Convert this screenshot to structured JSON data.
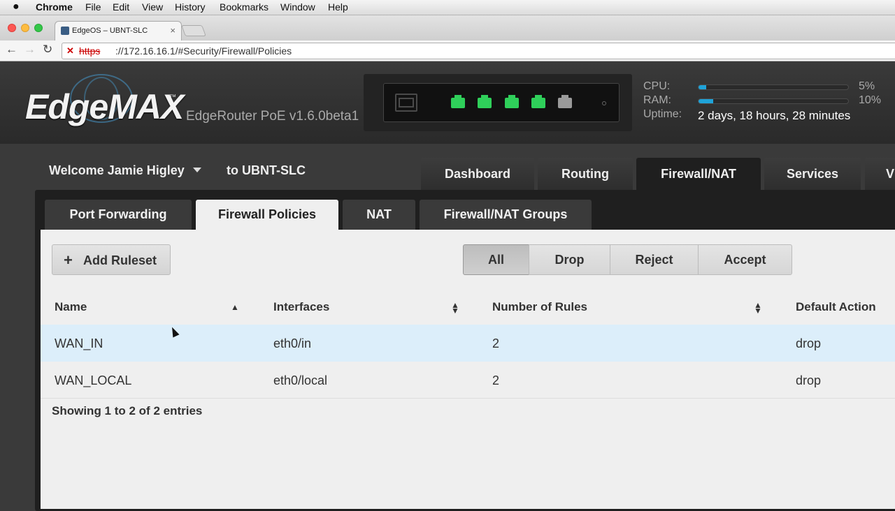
{
  "menubar": {
    "app": "Chrome",
    "items": [
      "File",
      "Edit",
      "View",
      "History",
      "Bookmarks",
      "Window",
      "Help"
    ]
  },
  "browser": {
    "tab_title": "EdgeOS – UBNT-SLC",
    "url_scheme": "https",
    "url_rest": "://172.16.16.1/#Security/Firewall/Policies"
  },
  "header": {
    "logo": "EdgeMAX",
    "trademark": "™",
    "model": "EdgeRouter PoE v1.6.0beta1",
    "ports": [
      "on",
      "on",
      "on",
      "on",
      "off"
    ],
    "stats": {
      "cpu_label": "CPU:",
      "cpu_pct": "5%",
      "cpu_value": 0.05,
      "ram_label": "RAM:",
      "ram_pct": "10%",
      "ram_value": 0.1,
      "uptime_label": "Uptime:",
      "uptime_value": "2 days, 18 hours, 28 minutes"
    },
    "accent_color": "#1fa3d9"
  },
  "nav": {
    "welcome": "Welcome Jamie Higley",
    "to": "to UBNT-SLC",
    "tabs": [
      "Dashboard",
      "Routing",
      "Firewall/NAT",
      "Services",
      "V"
    ],
    "active_tab": "Firewall/NAT"
  },
  "subtabs": {
    "items": [
      "Port Forwarding",
      "Firewall Policies",
      "NAT",
      "Firewall/NAT Groups"
    ],
    "active": "Firewall Policies"
  },
  "toolbar": {
    "add_label": "Add Ruleset",
    "filters": [
      "All",
      "Drop",
      "Reject",
      "Accept"
    ],
    "active_filter": "All"
  },
  "table": {
    "columns": [
      "Name",
      "Interfaces",
      "Number of Rules",
      "Default Action"
    ],
    "rows": [
      {
        "name": "WAN_IN",
        "interfaces": "eth0/in",
        "rules": "2",
        "action": "drop"
      },
      {
        "name": "WAN_LOCAL",
        "interfaces": "eth0/local",
        "rules": "2",
        "action": "drop"
      }
    ],
    "footer": "Showing 1 to 2 of 2 entries"
  }
}
